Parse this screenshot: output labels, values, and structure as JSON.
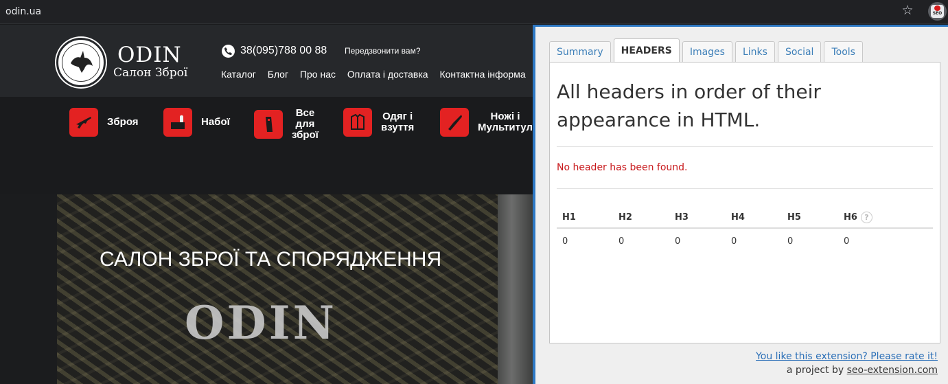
{
  "browser": {
    "url": "odin.ua",
    "star_icon": "star-icon",
    "extension_label": "SEO"
  },
  "site": {
    "brand_name": "ODIN",
    "brand_sub": "Салон Зброї",
    "phone": "38(095)788 00 88",
    "callback": "Передзвонити вам?",
    "nav": [
      "Каталог",
      "Блог",
      "Про нас",
      "Оплата і доставка",
      "Контактна інформа"
    ],
    "categories": [
      {
        "label": "Зброя",
        "icon": "rifle-icon"
      },
      {
        "label": "Набої",
        "icon": "ammo-icon"
      },
      {
        "label_lines": [
          "Все",
          "для",
          "зброї"
        ],
        "icon": "magazine-icon"
      },
      {
        "label_lines": [
          "Одяг і",
          "взуття"
        ],
        "icon": "clothing-icon"
      },
      {
        "label_lines": [
          "Ножі і",
          "Мультитул"
        ],
        "icon": "knife-icon"
      }
    ],
    "hero_title": "САЛОН ЗБРОЇ ТА СПОРЯДЖЕННЯ",
    "hero_logo": "ODIN"
  },
  "extension": {
    "tabs": [
      "Summary",
      "HEADERS",
      "Images",
      "Links",
      "Social",
      "Tools"
    ],
    "active_tab": "HEADERS",
    "title": "All headers in order of their appearance in HTML.",
    "not_found": "No header has been found.",
    "headers": [
      "H1",
      "H2",
      "H3",
      "H4",
      "H5",
      "H6"
    ],
    "counts": [
      "0",
      "0",
      "0",
      "0",
      "0",
      "0"
    ],
    "help_glyph": "?",
    "rate_link": "You like this extension? Please rate it!",
    "project_prefix": "a project by",
    "project_link": "seo-extension.com",
    "colors": {
      "accent": "#2d78c4",
      "error": "#c8191c",
      "category": "#e32222"
    }
  }
}
